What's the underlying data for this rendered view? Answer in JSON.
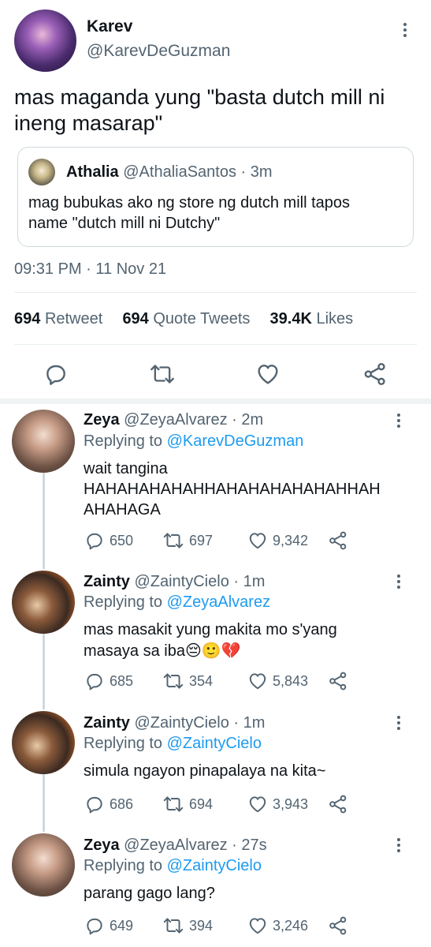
{
  "tweet": {
    "author_name": "Karev",
    "author_handle": "@KarevDeGuzman",
    "text_line1": "mas maganda yung \"basta dutch mill ni",
    "text_line2": "ineng masarap\"",
    "timestamp": "09:31 PM · 11 Nov 21",
    "stats": {
      "retweets_count": "694",
      "retweets_label": "Retweet",
      "quotes_count": "694",
      "quotes_label": "Quote Tweets",
      "likes_count": "39.4K",
      "likes_label": "Likes"
    },
    "quoted": {
      "name": "Athalia",
      "handle_time": "@AthaliaSantos · 3m",
      "text_line1": "mag bubukas ako ng store ng dutch mill tapos",
      "text_line2": "name \"dutch mill ni Dutchy\""
    }
  },
  "replies": [
    {
      "name": "Zeya",
      "handle_time": "@ZeyaAlvarez · 2m",
      "replying_prefix": "Replying to",
      "replying_to": "@KarevDeGuzman",
      "text_line1": "wait tangina",
      "text_line2": "HAHAHAHAHAHHAHAHAHAHAHAHHAH",
      "text_line3": "AHAHAGA",
      "replies": "650",
      "retweets": "697",
      "likes": "9,342"
    },
    {
      "name": "Zainty",
      "handle_time": "@ZaintyCielo · 1m",
      "replying_prefix": "Replying to",
      "replying_to": "@ZeyaAlvarez",
      "text_line1": "mas masakit yung makita mo s'yang",
      "text_line2": "masaya sa iba😔🙂💔",
      "replies": "685",
      "retweets": "354",
      "likes": "5,843"
    },
    {
      "name": "Zainty",
      "handle_time": "@ZaintyCielo · 1m",
      "replying_prefix": "Replying to",
      "replying_to": "@ZaintyCielo",
      "text_line1": "simula ngayon pinapalaya na kita~",
      "replies": "686",
      "retweets": "694",
      "likes": "3,943"
    },
    {
      "name": "Zeya",
      "handle_time": "@ZeyaAlvarez · 27s",
      "replying_prefix": "Replying to",
      "replying_to": "@ZaintyCielo",
      "text_line1": "parang gago lang?",
      "replies": "649",
      "retweets": "394",
      "likes": "3,246"
    }
  ],
  "icons": {
    "reply": "reply-icon",
    "retweet": "retweet-icon",
    "like": "heart-icon",
    "share": "share-icon",
    "more": "more-icon"
  },
  "colors": {
    "link": "#1d9bf0",
    "muted": "#536471",
    "text": "#0f1419",
    "border": "#cfd9de"
  }
}
